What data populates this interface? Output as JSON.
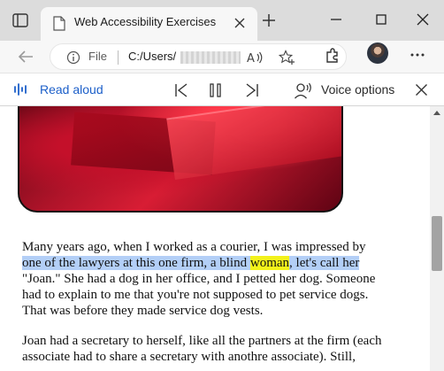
{
  "tab": {
    "title": "Web Accessibility Exercises"
  },
  "address_bar": {
    "scheme_label": "File",
    "url_prefix": "C:/Users/"
  },
  "read_aloud": {
    "label": "Read aloud",
    "voice_options_label": "Voice options"
  },
  "article": {
    "p1_lines": [
      "Many years ago, when I worked as a courier, I was impressed by",
      {
        "before": "",
        "sent_a": "one of the lawyers at this one firm, a blind ",
        "word": "woman",
        "sent_b": ", let's call her",
        "after": ""
      },
      "\"Joan.\" She had a dog in her office, and I petted her dog. Someone",
      "had to explain to me that you're not supposed to pet service dogs.",
      "That was before they made service dog vests."
    ],
    "p2_lines": [
      "Joan had a secretary to herself, like all the partners at the firm (each",
      "associate had to share a secretary with anothre associate). Still,"
    ]
  },
  "colors": {
    "sentence_highlight": "#b3cff7",
    "word_highlight": "#f3f21b",
    "read_aloud_accent": "#1c5fc9",
    "tabstrip_bg": "#dcdcdc"
  },
  "icons": [
    "window-icon",
    "favicon",
    "close-icon",
    "new-tab-icon",
    "minimize-icon",
    "maximize-icon",
    "back-icon",
    "info-icon",
    "read-aloud-icon",
    "add-favorite-icon",
    "extensions-icon",
    "avatar",
    "more-icon",
    "previous-icon",
    "pause-icon",
    "next-icon",
    "voice-icon",
    "scroll-up-icon"
  ]
}
